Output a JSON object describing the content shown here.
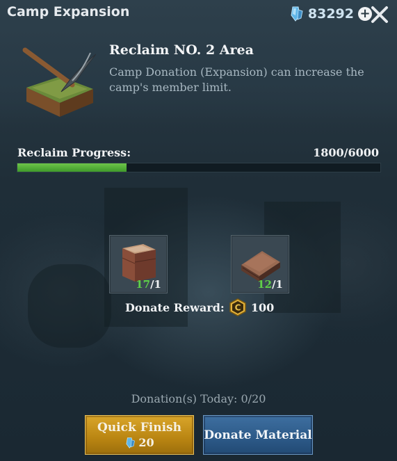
{
  "header": {
    "title": "Camp Expansion",
    "currency_amount": "83292"
  },
  "area": {
    "title": "Reclaim NO. 2 Area",
    "description": "Camp Donation (Expansion) can increase the camp's member limit."
  },
  "progress": {
    "label": "Reclaim Progress:",
    "value_text": "1800/6000",
    "current": 1800,
    "total": 6000
  },
  "materials": [
    {
      "icon": "wood-crate-icon",
      "have": "17",
      "need": "/1"
    },
    {
      "icon": "metal-plate-icon",
      "have": "12",
      "need": "/1"
    }
  ],
  "reward": {
    "label": "Donate Reward:",
    "coin_letter": "C",
    "amount": "100"
  },
  "donations_today": "Donation(s) Today: 0/20",
  "buttons": {
    "quick_finish": "Quick Finish",
    "quick_finish_cost": "20",
    "donate_material": "Donate Material"
  },
  "colors": {
    "progress_fill": "#5fb83c",
    "have_count": "#5fd048",
    "quick_finish_bg": "#c8951c",
    "donate_bg": "#2f5d8c"
  }
}
